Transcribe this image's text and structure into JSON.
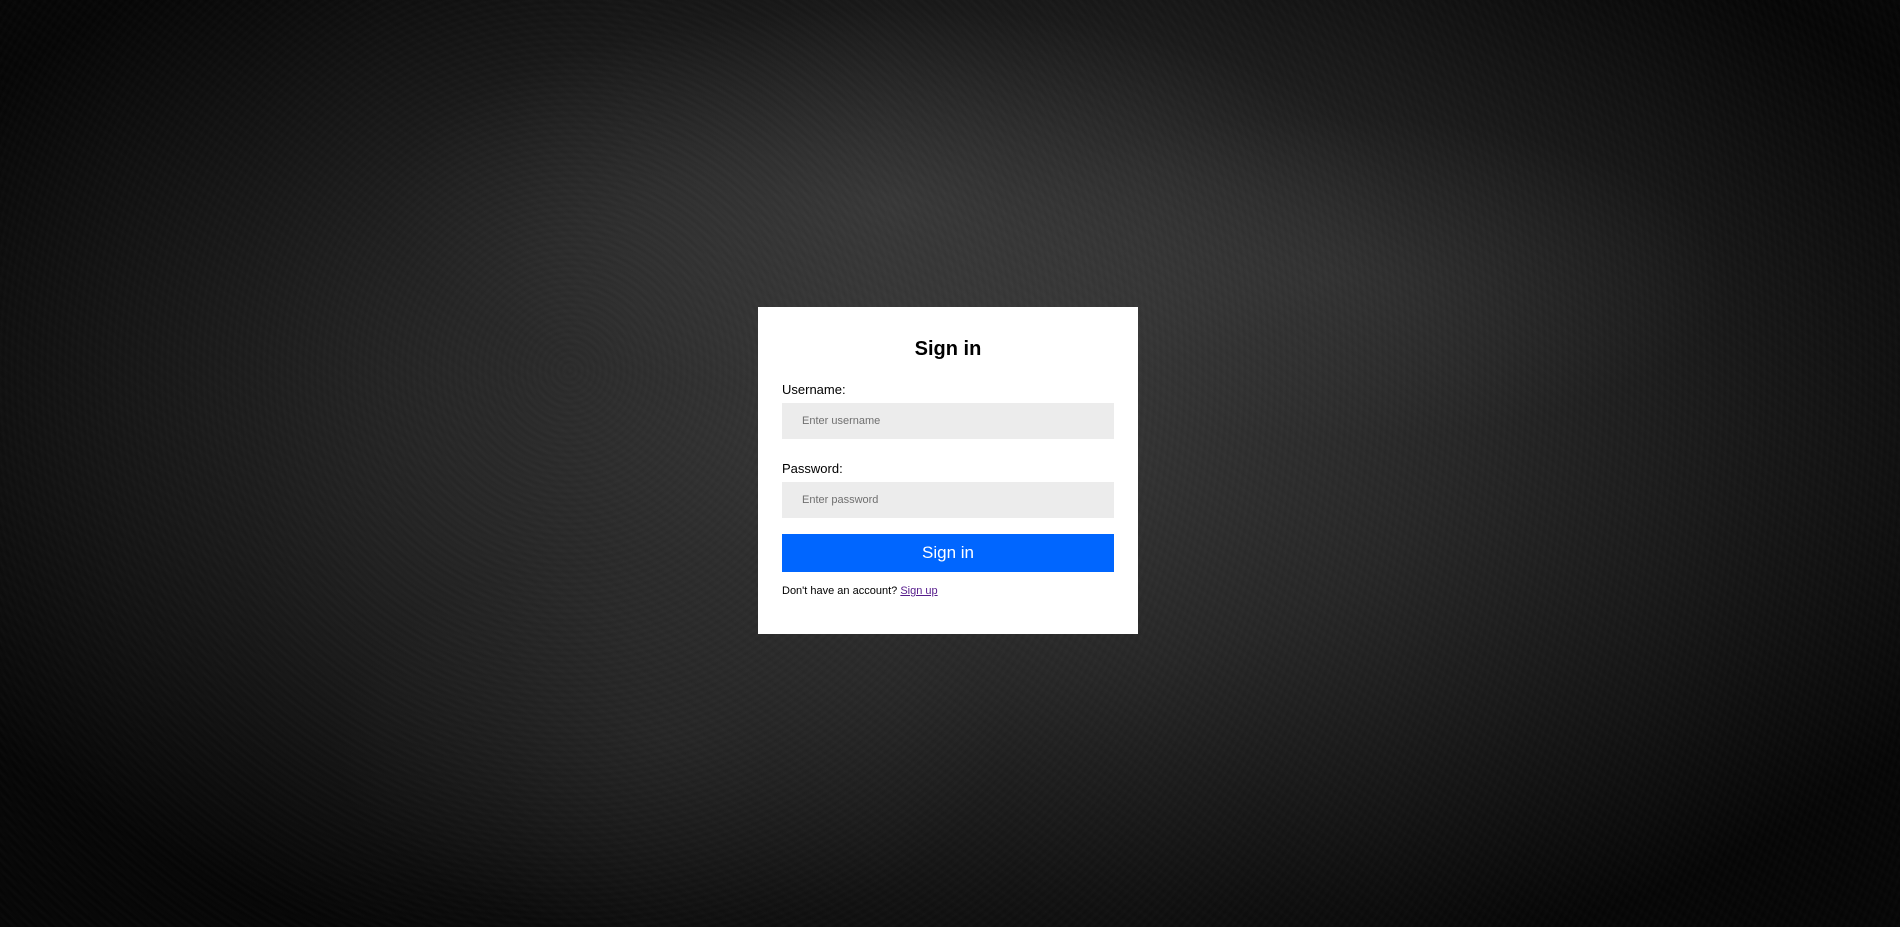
{
  "login": {
    "title": "Sign in",
    "username": {
      "label": "Username:",
      "placeholder": "Enter username",
      "value": ""
    },
    "password": {
      "label": "Password:",
      "placeholder": "Enter password",
      "value": ""
    },
    "submit_label": "Sign in",
    "signup_prompt": "Don't have an account?",
    "signup_link": "Sign up"
  },
  "colors": {
    "primary_button": "#0066ff",
    "input_background": "#ececec",
    "card_background": "#ffffff",
    "visited_link": "#551a8b"
  }
}
